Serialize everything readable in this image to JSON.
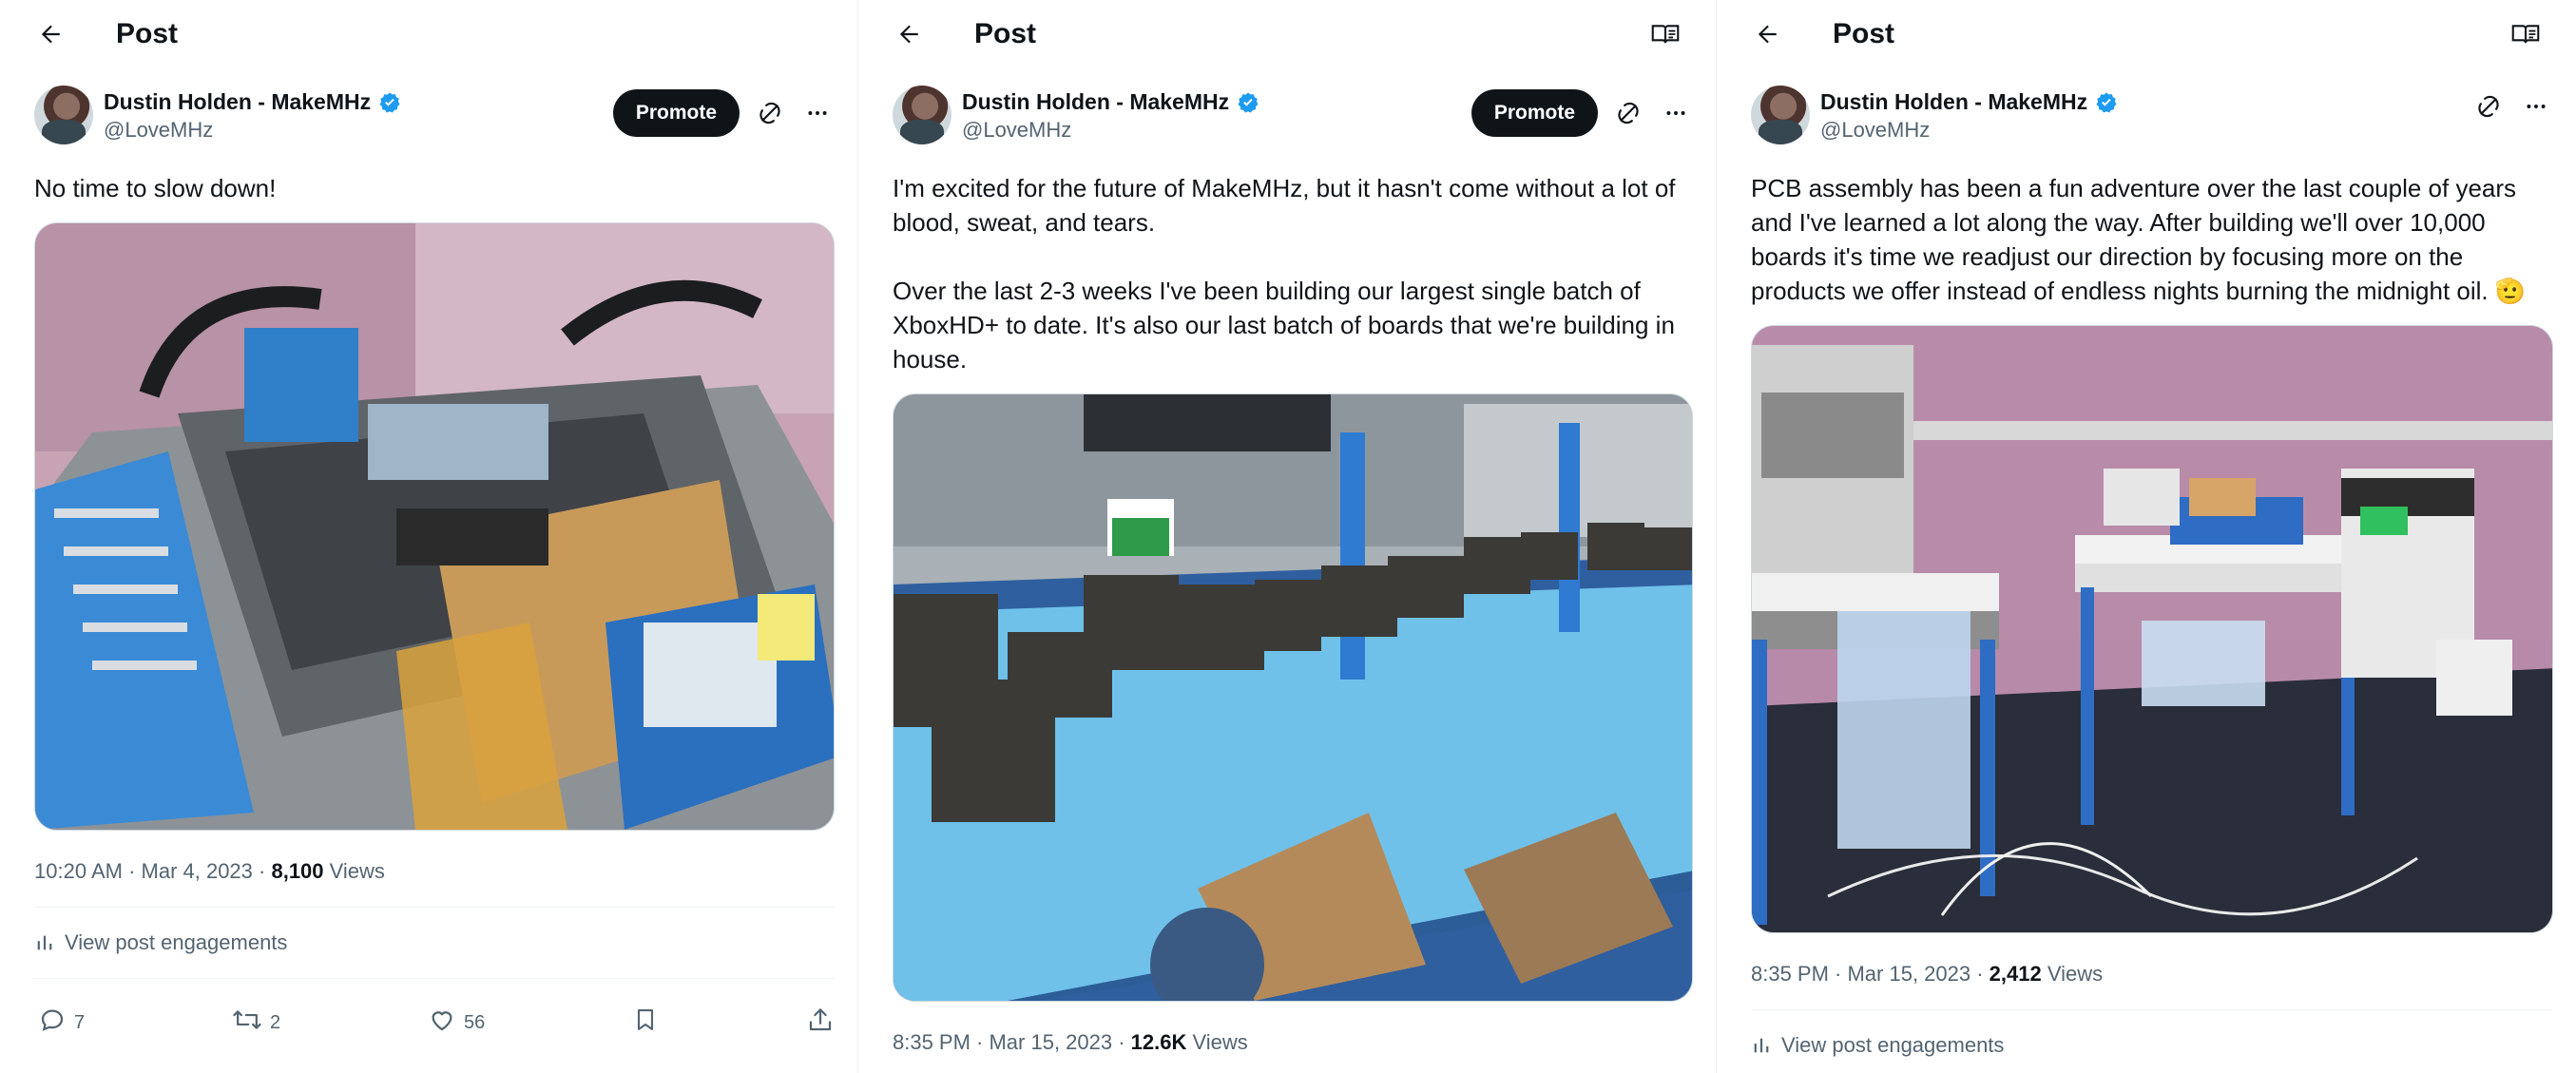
{
  "panels": [
    {
      "header": {
        "title": "Post",
        "show_reader": false
      },
      "author": {
        "name": "Dustin Holden - MakeMHz",
        "handle": "@LoveMHz"
      },
      "promote_label": "Promote",
      "text": "No time to slow down!",
      "meta": {
        "time": "10:20 AM · Mar 4, 2023 · ",
        "views_count": "8,100",
        "views_label": " Views"
      },
      "engagements_label": "View post engagements",
      "stats": {
        "replies": "7",
        "reposts": "2",
        "likes": "56"
      }
    },
    {
      "header": {
        "title": "Post",
        "show_reader": true
      },
      "author": {
        "name": "Dustin Holden - MakeMHz",
        "handle": "@LoveMHz"
      },
      "promote_label": "Promote",
      "text": "I'm excited for the future of MakeMHz, but it hasn't come without a lot of blood, sweat, and tears.\n\nOver the last 2-3 weeks I've been building our largest single batch of XboxHD+ to date. It's also our last batch of boards that we're building in house.",
      "meta": {
        "time": "8:35 PM · Mar 15, 2023 · ",
        "views_count": "12.6K",
        "views_label": " Views"
      }
    },
    {
      "header": {
        "title": "Post",
        "show_reader": true
      },
      "author": {
        "name": "Dustin Holden - MakeMHz",
        "handle": "@LoveMHz"
      },
      "text": "PCB assembly has been a fun adventure over the last couple of years and I've learned a lot along the way. After building we'll over 10,000 boards it's time we readjust our direction by focusing more on the products we offer instead of endless nights burning the midnight oil. 🫡",
      "meta": {
        "time": "8:35 PM · Mar 15, 2023 · ",
        "views_count": "2,412",
        "views_label": " Views"
      },
      "engagements_label": "View post engagements"
    }
  ],
  "icons": {
    "back": "arrow-left-icon",
    "reader": "reader-mode-icon",
    "verified": "verified-badge-icon",
    "grok": "grok-icon",
    "more": "more-dots-icon",
    "analytics": "analytics-bar-icon",
    "reply": "reply-icon",
    "repost": "repost-icon",
    "like": "heart-icon",
    "bookmark": "bookmark-icon",
    "share": "share-icon"
  },
  "colors": {
    "verified": "#1d9bf0",
    "text": "#0f1419",
    "secondary": "#536471",
    "divider": "#eff3f4"
  }
}
